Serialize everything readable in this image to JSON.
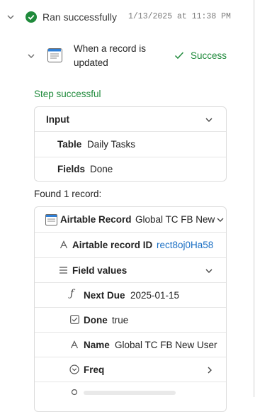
{
  "run": {
    "status": "Ran successfully",
    "timestamp": "1/13/2025 at 11:38 PM"
  },
  "step": {
    "title": "When a record is updated",
    "result": "Success",
    "status_text": "Step successful"
  },
  "input": {
    "heading": "Input",
    "fields": [
      {
        "label": "Table",
        "value": "Daily Tasks"
      },
      {
        "label": "Fields",
        "value": "Done"
      }
    ]
  },
  "found_text": "Found 1 record:",
  "record": {
    "label": "Airtable Record",
    "name": "Global TC FB New",
    "id_label": "Airtable record ID",
    "id_value": "rect8oj0Ha58",
    "field_values_label": "Field values",
    "fields": [
      {
        "icon": "formula-icon",
        "label": "Next Due",
        "value": "2025-01-15"
      },
      {
        "icon": "checkbox-icon",
        "label": "Done",
        "value": "true"
      },
      {
        "icon": "text-field-icon",
        "label": "Name",
        "value": "Global TC FB New User"
      },
      {
        "icon": "single-select-icon",
        "label": "Freq",
        "value": ""
      }
    ]
  },
  "colors": {
    "success_green": "#1f8a3b",
    "link_blue": "#1a6fc4",
    "border": "#dcdcdc"
  }
}
